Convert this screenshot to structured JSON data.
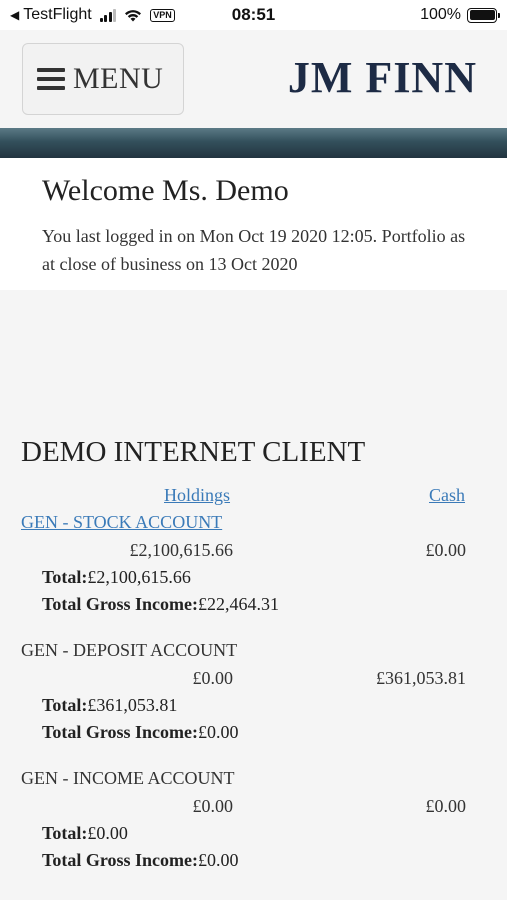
{
  "status_bar": {
    "back_app": "TestFlight",
    "vpn": "VPN",
    "time": "08:51",
    "battery": "100%"
  },
  "header": {
    "menu_label": "MENU",
    "logo": "JM FINN"
  },
  "welcome": {
    "title": "Welcome Ms. Demo",
    "message": "You last logged in on Mon Oct 19 2020 12:05. Portfolio as at close of business on 13 Oct 2020"
  },
  "client": {
    "name": "DEMO INTERNET CLIENT",
    "columns": {
      "holdings": "Holdings",
      "cash": "Cash"
    },
    "accounts": [
      {
        "name": "GEN - STOCK ACCOUNT",
        "holdings": "£2,100,615.66",
        "cash": "£0.00",
        "total_label": "Total:",
        "total": "£2,100,615.66",
        "income_label": "Total Gross Income:",
        "income": "£22,464.31"
      },
      {
        "name": "GEN - DEPOSIT ACCOUNT",
        "holdings": "£0.00",
        "cash": "£361,053.81",
        "total_label": "Total:",
        "total": "£361,053.81",
        "income_label": "Total Gross Income:",
        "income": "£0.00"
      },
      {
        "name": "GEN - INCOME ACCOUNT",
        "holdings": "£0.00",
        "cash": "£0.00",
        "total_label": "Total:",
        "total": "£0.00",
        "income_label": "Total Gross Income:",
        "income": "£0.00"
      }
    ]
  }
}
